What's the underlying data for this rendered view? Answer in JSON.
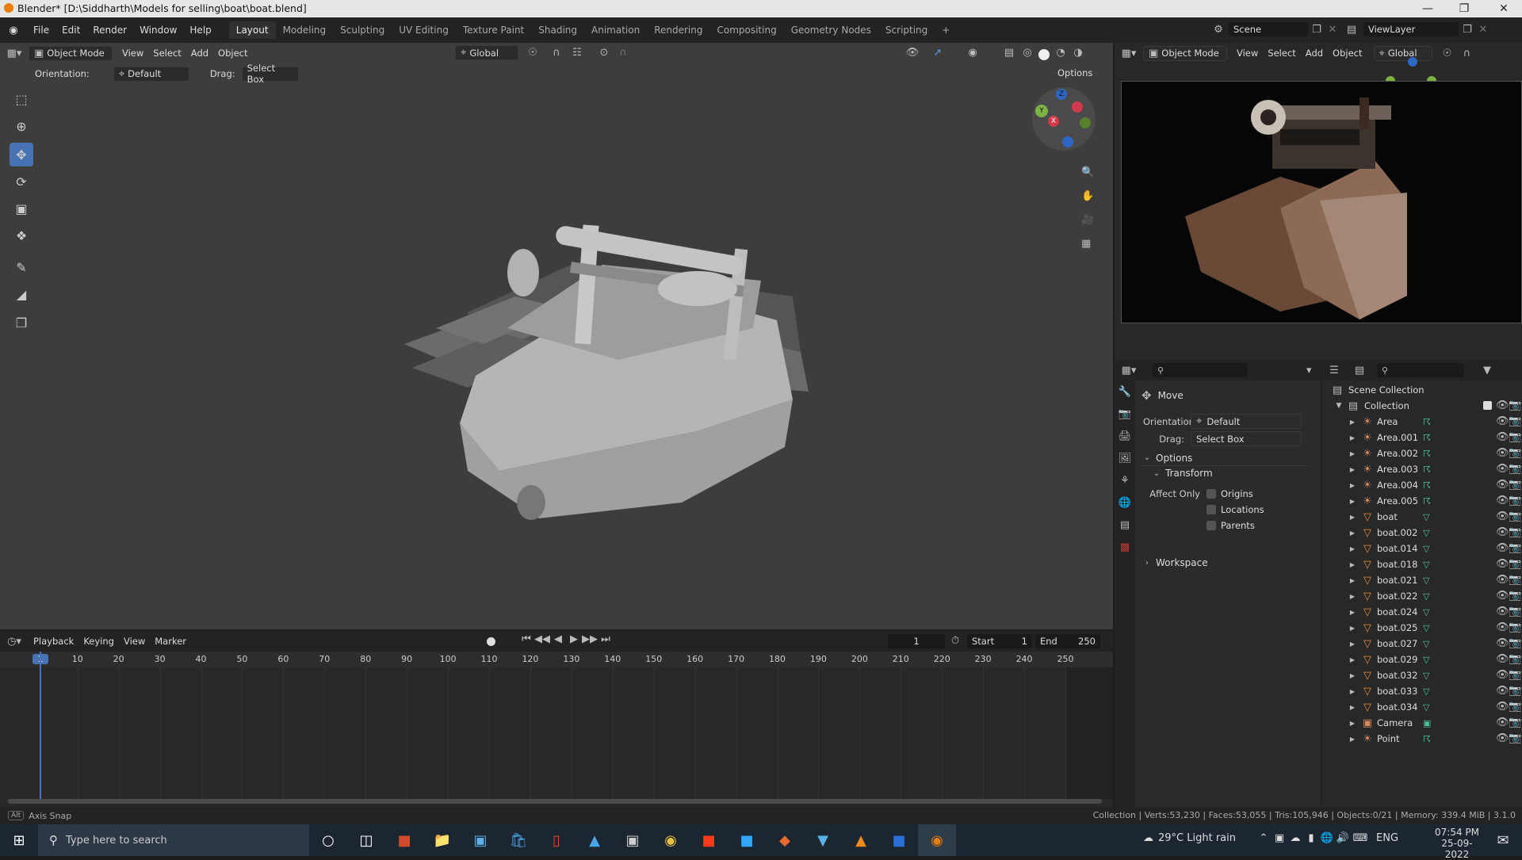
{
  "window": {
    "title": "Blender* [D:\\Siddharth\\Models for selling\\boat\\boat.blend]"
  },
  "menu": [
    "File",
    "Edit",
    "Render",
    "Window",
    "Help"
  ],
  "workspaces": [
    "Layout",
    "Modeling",
    "Sculpting",
    "UV Editing",
    "Texture Paint",
    "Shading",
    "Animation",
    "Rendering",
    "Compositing",
    "Geometry Nodes",
    "Scripting",
    "+"
  ],
  "scene": {
    "name": "Scene",
    "view_layer": "ViewLayer"
  },
  "viewport_header": {
    "mode": "Object Mode",
    "view": "View",
    "select": "Select",
    "add": "Add",
    "object": "Object",
    "transform": "Global"
  },
  "tool_settings": {
    "orientation_label": "Orientation:",
    "orientation": "Default",
    "drag_label": "Drag:",
    "drag": "Select Box",
    "options": "Options"
  },
  "preview_header": {
    "mode": "Object Mode",
    "view": "View",
    "select": "Select",
    "add": "Add",
    "object": "Object",
    "transform": "Global"
  },
  "props": {
    "operator": "Move",
    "orientation_label": "Orientation",
    "orientation": "Default",
    "drag_label": "Drag:",
    "drag": "Select Box",
    "options": "Options",
    "transform": "Transform",
    "affect_only": "Affect Only",
    "origins": "Origins",
    "locations": "Locations",
    "parents": "Parents",
    "workspace": "Workspace"
  },
  "outliner": {
    "root": "Scene Collection",
    "collection": "Collection",
    "items": [
      {
        "name": "Area",
        "type": "light"
      },
      {
        "name": "Area.001",
        "type": "light"
      },
      {
        "name": "Area.002",
        "type": "light"
      },
      {
        "name": "Area.003",
        "type": "light"
      },
      {
        "name": "Area.004",
        "type": "light"
      },
      {
        "name": "Area.005",
        "type": "light"
      },
      {
        "name": "boat",
        "type": "mesh"
      },
      {
        "name": "boat.002",
        "type": "mesh"
      },
      {
        "name": "boat.014",
        "type": "mesh"
      },
      {
        "name": "boat.018",
        "type": "mesh"
      },
      {
        "name": "boat.021",
        "type": "mesh"
      },
      {
        "name": "boat.022",
        "type": "mesh"
      },
      {
        "name": "boat.024",
        "type": "mesh"
      },
      {
        "name": "boat.025",
        "type": "mesh"
      },
      {
        "name": "boat.027",
        "type": "mesh"
      },
      {
        "name": "boat.029",
        "type": "mesh"
      },
      {
        "name": "boat.032",
        "type": "mesh"
      },
      {
        "name": "boat.033",
        "type": "mesh"
      },
      {
        "name": "boat.034",
        "type": "mesh"
      },
      {
        "name": "Camera",
        "type": "camera"
      },
      {
        "name": "Point",
        "type": "light"
      }
    ]
  },
  "timeline": {
    "playback": "Playback",
    "keying": "Keying",
    "view": "View",
    "marker": "Marker",
    "current_frame": "1",
    "start_label": "Start",
    "start": "1",
    "end_label": "End",
    "end": "250",
    "ticks": [
      "1",
      "10",
      "20",
      "30",
      "40",
      "50",
      "60",
      "70",
      "80",
      "90",
      "100",
      "110",
      "120",
      "130",
      "140",
      "150",
      "160",
      "170",
      "180",
      "190",
      "200",
      "210",
      "220",
      "230",
      "240",
      "250"
    ]
  },
  "status": {
    "left_key": "Alt",
    "left": "Axis Snap",
    "right": "Collection | Verts:53,230 | Faces:53,055 | Tris:105,946 | Objects:0/21 | Memory: 339.4 MiB | 3.1.0"
  },
  "taskbar": {
    "search_placeholder": "Type here to search",
    "weather": "29°C  Light rain",
    "lang": "ENG",
    "time": "07:54 PM",
    "date": "25-09-2022"
  },
  "gizmo": {
    "x": "X",
    "y": "Y",
    "z": "Z"
  }
}
